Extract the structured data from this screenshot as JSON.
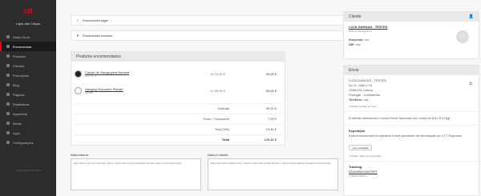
{
  "sidebar": {
    "logo": "ctt",
    "store": "Lojas das Calças",
    "items": [
      {
        "label": "Visão Geral",
        "icon": "home-icon",
        "active": false
      },
      {
        "label": "Encomendas",
        "icon": "cart-icon",
        "active": true
      },
      {
        "label": "Produtos",
        "icon": "box-icon",
        "active": false
      },
      {
        "label": "Clientes",
        "icon": "users-icon",
        "active": false
      },
      {
        "label": "Promoções",
        "icon": "tag-icon",
        "active": false
      },
      {
        "label": "Blog",
        "icon": "blog-icon",
        "active": false
      },
      {
        "label": "Páginas",
        "icon": "page-icon",
        "active": false
      },
      {
        "label": "Estatísticas",
        "icon": "chart-icon",
        "active": false
      },
      {
        "label": "Aparência",
        "icon": "brush-icon",
        "active": false
      },
      {
        "label": "Media",
        "icon": "image-icon",
        "active": false
      },
      {
        "label": "Apps",
        "icon": "apps-icon",
        "active": false
      },
      {
        "label": "Configurações",
        "icon": "gear-icon",
        "active": false
      }
    ],
    "version": "Lojas Online CTT 3.0.0"
  },
  "alerts": {
    "paid": {
      "text": "Encomenda paga",
      "button": "Marcar como não paga"
    },
    "sent": {
      "text": "Encomenda enviada",
      "button": "Alterar estado"
    }
  },
  "products": {
    "title": "Produtos encomendados",
    "items": [
      {
        "name": "Calças de Ganga para Homem",
        "sub": "azul - S - 1",
        "qty": "2x 15,00 €",
        "total": "30,00 €"
      },
      {
        "name": "Hanging Succulent Planter",
        "sub": "x6833X",
        "qty": "1x 65,00 €",
        "total": "65,00 €"
      }
    ],
    "subtotal_label": "Subtotal",
    "subtotal": "95,00 €",
    "shipping_label": "Envio / Transporte",
    "shipping": "7,00 €",
    "tax_label": "Taxa (IVA)",
    "tax": "23,46 €",
    "total_label": "Total",
    "total": "125,46 €"
  },
  "notes": {
    "internal_label": "Nota interna",
    "internal_placeholder": "Esta nota é interna e somente para si. Pode usar a para anotações internas sobre a sua encomenda",
    "client_label": "Nota p/ cliente",
    "client_placeholder": "Esta nota será enviada para o cliente. Pode usar a para informar o cliente sobre alguma questão da encomenda"
  },
  "client": {
    "title": "Cliente",
    "name": "LOJA GANGAS - TESTES",
    "email": "pedro.a.neves@ctt.pt",
    "empresa_label": "Empresa:",
    "empresa": "n/a",
    "nif_label": "NIF:",
    "nif": "n/a",
    "initials": "LT"
  },
  "envio": {
    "title": "Envio",
    "lines": [
      "LOJA GANGAS - TESTES",
      "Av. D. João II 14",
      "1999-001 Lisboa",
      "Portugal - Continental"
    ],
    "phone_label": "Telefone:",
    "phone": "n/a",
    "edit": "Editar morada de envio",
    "shipping_note": "O cliente selecionou o envio Envio Nacional com custo de 8,61 € (3 kg)",
    "expedicao_title": "Expedição",
    "expedicao_text": "Esta encomenda foi expedida e está pendente de informação do CTT Expresso.",
    "expedicao_btn": "ver expedição",
    "expedicao_remove": "Editar / Remover expedição",
    "tracking_title": "Tracking",
    "tracking_code": "DA9052016975PT",
    "tracking_edit": "Editar tracking"
  }
}
